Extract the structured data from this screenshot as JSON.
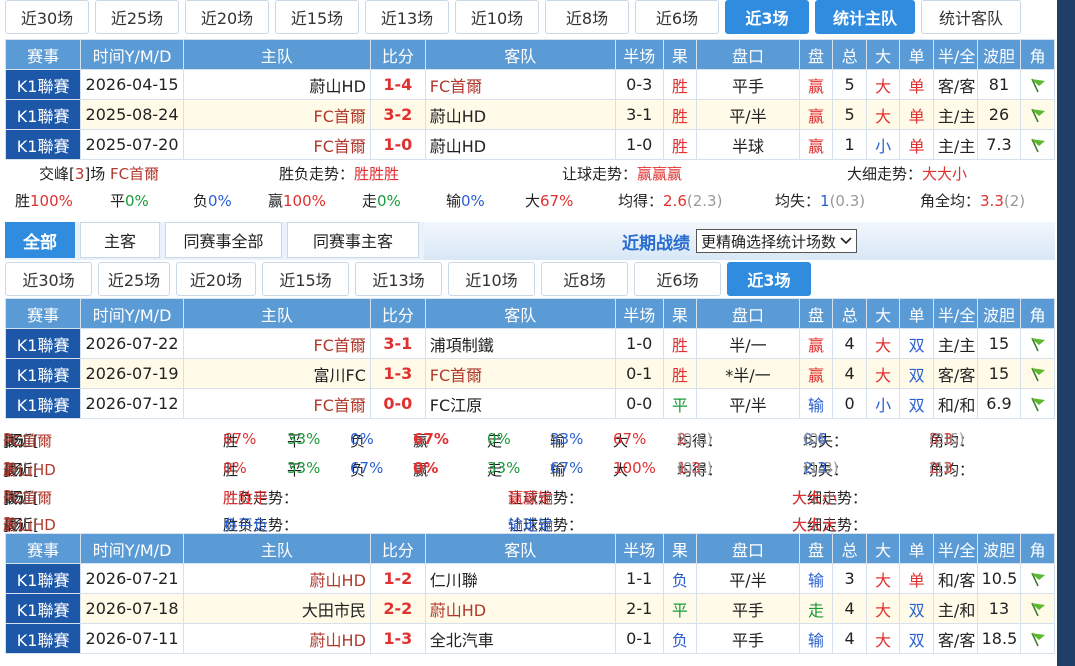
{
  "top_tabs": [
    "近30场",
    "近25场",
    "近20场",
    "近15场",
    "近13场",
    "近10场",
    "近8场",
    "近6场",
    "近3场",
    "统计主队",
    "统计客队"
  ],
  "headers": [
    "赛事",
    "时间Y/M/D",
    "主队",
    "比分",
    "客队",
    "半场",
    "果",
    "盘口",
    "盘",
    "总",
    "大",
    "单",
    "半/全",
    "波胆",
    "角"
  ],
  "h2h_rows": [
    {
      "comp": "K1聯賽",
      "date": "2026-04-15",
      "home": "蔚山HD",
      "score": "1-4",
      "away": "FC首爾",
      "half": "0-3",
      "res": "胜",
      "line": "平手",
      "pan": "赢",
      "total": "5",
      "big": "大",
      "odd": "单",
      "hf": "客/客",
      "bodan": "81"
    },
    {
      "comp": "K1聯賽",
      "date": "2025-08-24",
      "home": "FC首爾",
      "score": "3-2",
      "away": "蔚山HD",
      "half": "3-1",
      "res": "胜",
      "line": "平/半",
      "pan": "赢",
      "total": "5",
      "big": "大",
      "odd": "单",
      "hf": "主/主",
      "bodan": "26"
    },
    {
      "comp": "K1聯賽",
      "date": "2025-07-20",
      "home": "FC首爾",
      "score": "1-0",
      "away": "蔚山HD",
      "half": "1-0",
      "res": "胜",
      "line": "半球",
      "pan": "赢",
      "total": "1",
      "big": "小",
      "odd": "单",
      "hf": "主/主",
      "bodan": "7.3"
    }
  ],
  "h2h_summary": {
    "jiaofeng_pre": "交峰[",
    "jiaofeng_n": "3",
    "jiaofeng_post": "]场",
    "team": "FC首爾",
    "wl_label": "胜负走势：",
    "wl_val": "胜胜胜",
    "rq_label": "让球走势：",
    "rq_val": "赢赢赢",
    "dx_label": "大细走势：",
    "dx_val": "大大小"
  },
  "h2h_stats": {
    "win_l": "胜",
    "win_v": "100%",
    "draw_l": "平",
    "draw_v": "0%",
    "lose_l": "负",
    "lose_v": "0%",
    "ying_l": "赢",
    "ying_v": "100%",
    "zou_l": "走",
    "zou_v": "0%",
    "shu_l": "输",
    "shu_v": "0%",
    "da_l": "大",
    "da_v": "67%",
    "avg_get_l": "均得：",
    "avg_get_v": "2.6",
    "avg_get_s": "(2.3)",
    "avg_lose_l": "均失：",
    "avg_lose_v": "1",
    "avg_lose_s": "(0.3)",
    "corner_l": "角全均：",
    "corner_v": "3.3",
    "corner_s": "(2)"
  },
  "section_tabs": [
    "全部",
    "主客",
    "同赛事全部",
    "同赛事主客"
  ],
  "recent": {
    "title": "近期战绩",
    "select": "更精确选择统计场数"
  },
  "recent_tabs": [
    "近30场",
    "近25场",
    "近20场",
    "近15场",
    "近13场",
    "近10场",
    "近8场",
    "近6场",
    "近3场"
  ],
  "home_rows": [
    {
      "comp": "K1聯賽",
      "date": "2026-07-22",
      "home": "FC首爾",
      "score": "3-1",
      "away": "浦項制鐵",
      "half": "1-0",
      "res": "胜",
      "line": "半/一",
      "pan": "赢",
      "total": "4",
      "big": "大",
      "odd": "双",
      "hf": "主/主",
      "bodan": "15"
    },
    {
      "comp": "K1聯賽",
      "date": "2026-07-19",
      "home": "富川FC",
      "score": "1-3",
      "away": "FC首爾",
      "half": "0-1",
      "res": "胜",
      "line": "*半/一",
      "pan": "赢",
      "total": "4",
      "big": "大",
      "odd": "双",
      "hf": "客/客",
      "bodan": "15"
    },
    {
      "comp": "K1聯賽",
      "date": "2026-07-12",
      "home": "FC首爾",
      "score": "0-0",
      "away": "FC江原",
      "half": "0-0",
      "res": "平",
      "line": "平/半",
      "pan": "输",
      "total": "0",
      "big": "小",
      "odd": "双",
      "hf": "和/和",
      "bodan": "6.9"
    }
  ],
  "recent_stats": [
    {
      "pre": "最近[",
      "n": "3",
      "post": "]场",
      "team": "FC首爾",
      "win": "67%",
      "draw": "33%",
      "lose": "0%",
      "ying": "67%",
      "zou": "0%",
      "shu": "33%",
      "da": "67%",
      "get": "2",
      "get_s": "(0.6)",
      "lost": "0.6",
      "lost_s": "(0)",
      "corner": "5.3",
      "corner_s": "(2.6)"
    },
    {
      "pre": "最近[",
      "n": "3",
      "post": "]场",
      "team": "蔚山HD",
      "win": "0%",
      "draw": "33%",
      "lose": "67%",
      "ying": "0%",
      "zou": "33%",
      "shu": "67%",
      "da": "100%",
      "get": "1.3",
      "get_s": "(0.6)",
      "lost": "2.3",
      "lost_s": "(1.3)",
      "corner": "2.3",
      "corner_s": "(1)"
    }
  ],
  "stat_labels": {
    "win": "胜",
    "draw": "平",
    "lose": "负",
    "ying": "赢",
    "zou": "走",
    "shu": "输",
    "da": "大",
    "get": "均得：",
    "lost": "均失：",
    "corner": "角均："
  },
  "recent_trends": [
    {
      "pre": "最近[",
      "n": "3",
      "post": "]场",
      "team": "FC首爾",
      "wl_label": "胜负走势：",
      "wl": "胜胜平",
      "rq_label": "让球走势：",
      "rq": "赢赢输",
      "dx_label": "大细走势：",
      "dx": "大大小"
    },
    {
      "pre": "最近[",
      "n": "3",
      "post": "]场",
      "team": "蔚山HD",
      "wl_label": "胜负走势：",
      "wl": "负平负",
      "rq_label": "让球走势：",
      "rq": "输走输",
      "dx_label": "大细走势：",
      "dx": "大大大"
    }
  ],
  "away_rows": [
    {
      "comp": "K1聯賽",
      "date": "2026-07-21",
      "home": "蔚山HD",
      "score": "1-2",
      "away": "仁川聯",
      "half": "1-1",
      "res": "负",
      "line": "平/半",
      "pan": "输",
      "total": "3",
      "big": "大",
      "odd": "单",
      "hf": "和/客",
      "bodan": "10.5"
    },
    {
      "comp": "K1聯賽",
      "date": "2026-07-18",
      "home": "大田市民",
      "score": "2-2",
      "away": "蔚山HD",
      "half": "2-1",
      "res": "平",
      "line": "平手",
      "pan": "走",
      "total": "4",
      "big": "大",
      "odd": "双",
      "hf": "主/和",
      "bodan": "13"
    },
    {
      "comp": "K1聯賽",
      "date": "2026-07-11",
      "home": "蔚山HD",
      "score": "1-3",
      "away": "全北汽車",
      "half": "0-1",
      "res": "负",
      "line": "平手",
      "pan": "输",
      "total": "4",
      "big": "大",
      "odd": "双",
      "hf": "客/客",
      "bodan": "18.5"
    }
  ],
  "colors": {
    "header": "#5b9bd5",
    "comp": "#1c57a8",
    "active": "#2f8cde",
    "red": "#e03030",
    "blue": "#2a5fd0",
    "green": "#1a9a3a"
  }
}
